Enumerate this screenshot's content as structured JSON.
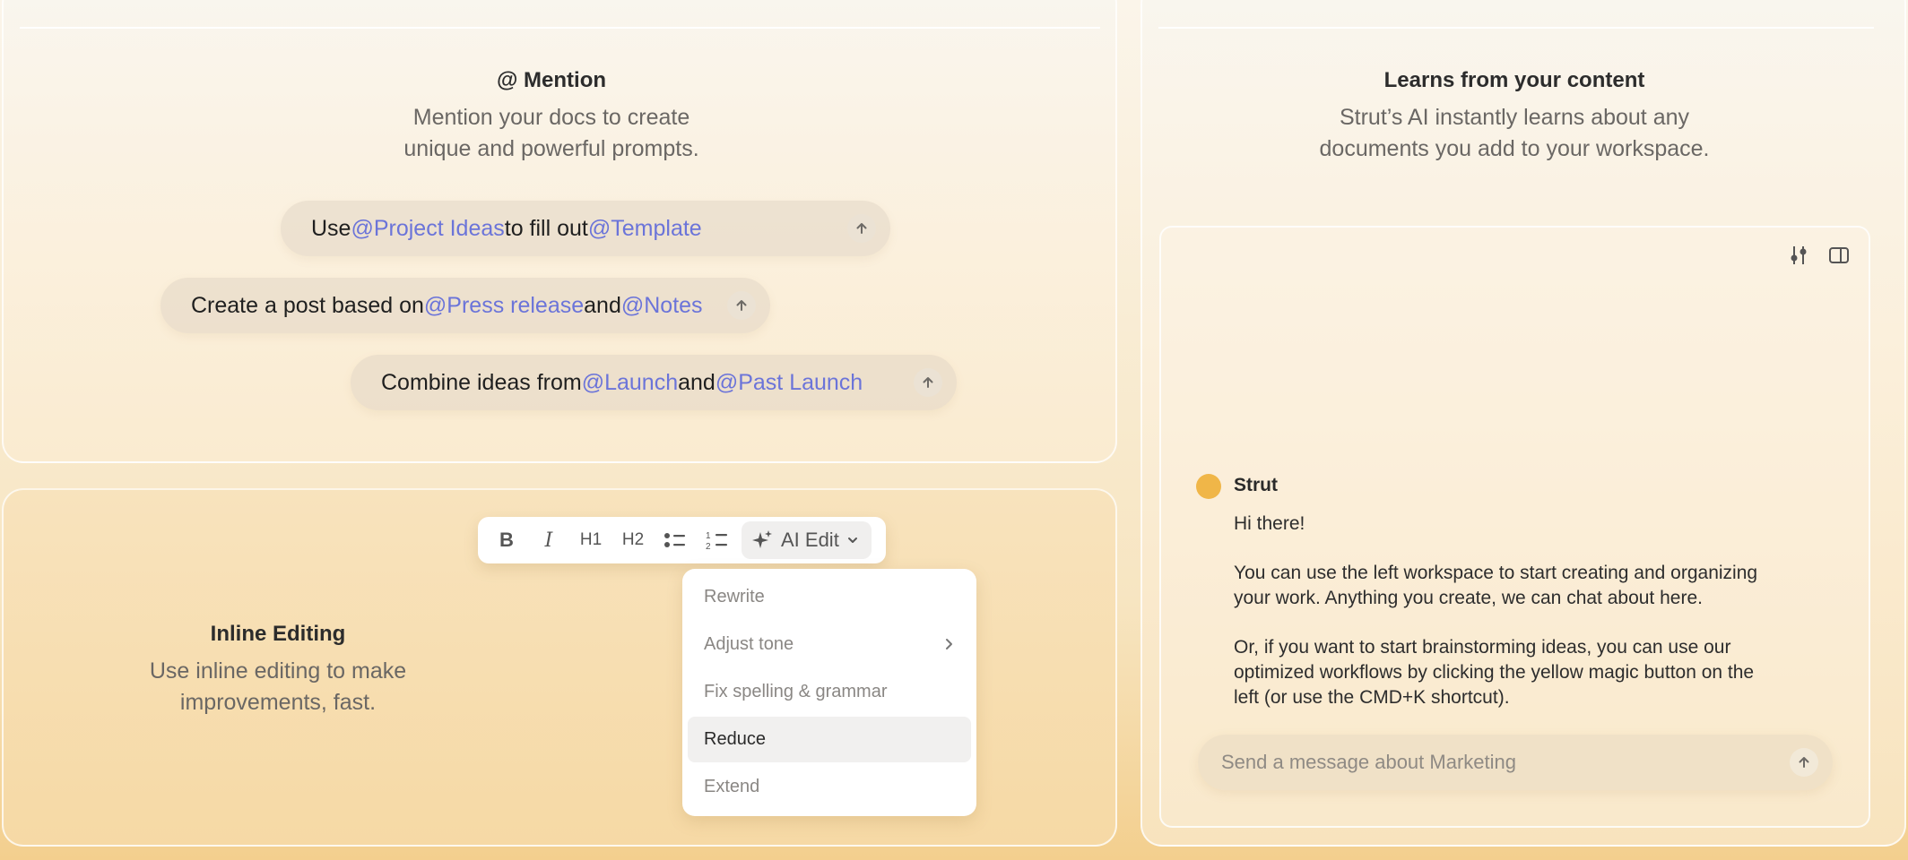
{
  "mention_card": {
    "title": "@ Mention",
    "desc_line1": "Mention your docs to create",
    "desc_line2": "unique and powerful prompts.",
    "prompts": [
      {
        "t1": "Use ",
        "m1": "@Project Ideas",
        "t2": " to fill out ",
        "m2": "@Template"
      },
      {
        "t1": "Create a post based on ",
        "m1": "@Press release",
        "t2": " and ",
        "m2": "@Notes"
      },
      {
        "t1": "Combine ideas from ",
        "m1": "@Launch",
        "t2": " and ",
        "m2": "@Past Launch"
      }
    ]
  },
  "inline_card": {
    "title": "Inline Editing",
    "desc_line1": "Use inline editing to make",
    "desc_line2": "improvements, fast.",
    "toolbar": {
      "bold": "B",
      "italic": "I",
      "h1": "H1",
      "h2": "H2",
      "ai_edit": "AI Edit"
    },
    "menu": [
      "Rewrite",
      "Adjust tone",
      "Fix spelling & grammar",
      "Reduce",
      "Extend"
    ],
    "active_menu_item": "Reduce"
  },
  "learn_card": {
    "title": "Learns from your content",
    "desc_line1": "Strut’s AI instantly learns about any",
    "desc_line2": "documents you add to your workspace.",
    "chat": {
      "bot_name": "Strut",
      "greeting": "Hi there!",
      "p1_line1": "You can use the left workspace to start creating and organizing",
      "p1_line2": "your work. Anything you create, we can chat about here.",
      "p2_line1": "Or, if you want to start brainstorming ideas, you can use our",
      "p2_line2": "optimized workflows by clicking the yellow magic button on the",
      "p2_line3": "left (or use the CMD+K shortcut).",
      "input_placeholder": "Send a message about Marketing"
    }
  },
  "colors": {
    "mention": "#6b74d9",
    "avatar": "#f0b648"
  },
  "icons": [
    "send-arrow-icon",
    "sparkle-icon",
    "chevron-down-icon",
    "chevron-right-icon",
    "settings-sliders-icon",
    "sidebar-panel-icon",
    "bullet-list-icon",
    "numbered-list-icon"
  ]
}
